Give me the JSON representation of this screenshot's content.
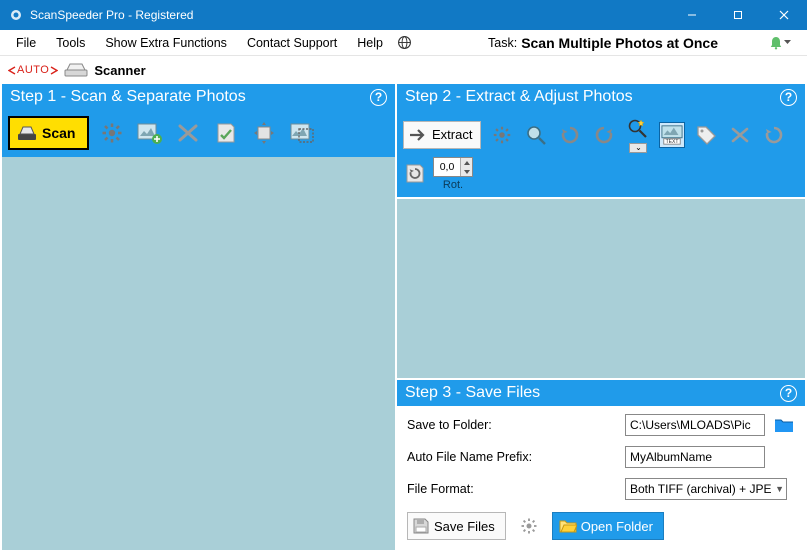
{
  "window": {
    "title": "ScanSpeeder Pro - Registered"
  },
  "menu": {
    "file": "File",
    "tools": "Tools",
    "extra": "Show Extra Functions",
    "contact": "Contact Support",
    "help": "Help",
    "task_label": "Task:",
    "task_value": "Scan Multiple Photos at Once"
  },
  "source": {
    "auto": "AUTO",
    "label": "Scanner"
  },
  "step1": {
    "header": "Step 1 - Scan & Separate Photos",
    "scan": "Scan"
  },
  "step2": {
    "header": "Step 2 - Extract & Adjust Photos",
    "extract": "Extract",
    "rotation_value": "0,0",
    "rotation_label": "Rot."
  },
  "step3": {
    "header": "Step 3 - Save Files",
    "save_to": "Save to Folder:",
    "folder_value": "C:\\Users\\MLOADS\\Pic",
    "prefix_label": "Auto File Name Prefix:",
    "prefix_value": "MyAlbumName",
    "format_label": "File Format:",
    "format_value": "Both TIFF (archival) + JPE",
    "save_files": "Save Files",
    "open_folder": "Open Folder"
  }
}
